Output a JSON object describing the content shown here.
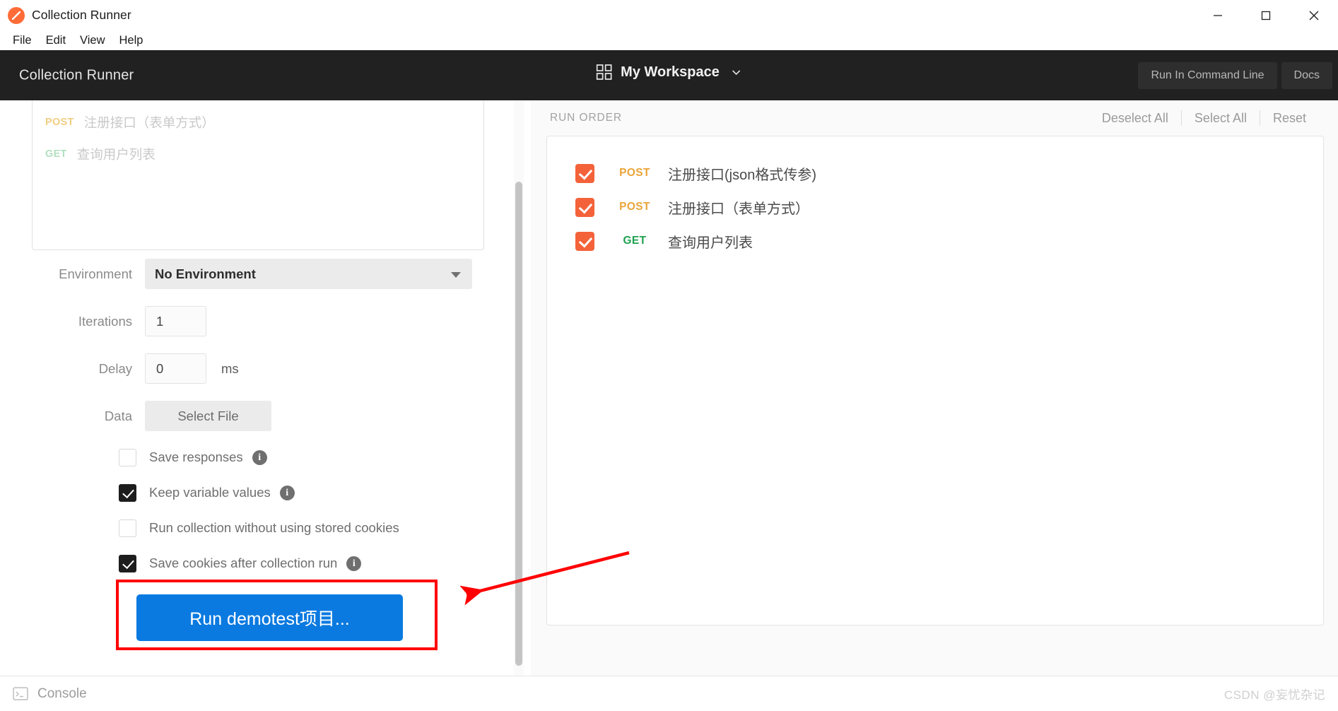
{
  "window": {
    "title": "Collection Runner",
    "app_icon": "postman-logo-icon",
    "controls": {
      "minimize": "minimize-icon",
      "maximize": "maximize-icon",
      "close": "close-icon"
    }
  },
  "menubar": {
    "items": [
      "File",
      "Edit",
      "View",
      "Help"
    ]
  },
  "header": {
    "title": "Collection Runner",
    "workspace": {
      "icon": "grid-icon",
      "name": "My Workspace",
      "chevron": "chevron-down-icon"
    },
    "actions": [
      {
        "label": "Run In Command Line"
      },
      {
        "label": "Docs"
      }
    ]
  },
  "left_panel": {
    "request_preview": [
      {
        "method": "POST",
        "name": "注册接口（表单方式）"
      },
      {
        "method": "GET",
        "name": "查询用户列表"
      }
    ],
    "form": {
      "environment": {
        "label": "Environment",
        "value": "No Environment"
      },
      "iterations": {
        "label": "Iterations",
        "value": "1"
      },
      "delay": {
        "label": "Delay",
        "value": "0",
        "unit": "ms"
      },
      "data": {
        "label": "Data",
        "button": "Select File"
      },
      "options": [
        {
          "label": "Save responses",
          "checked": false,
          "info": true
        },
        {
          "label": "Keep variable values",
          "checked": true,
          "info": true
        },
        {
          "label": "Run collection without using stored cookies",
          "checked": false,
          "info": false
        },
        {
          "label": "Save cookies after collection run",
          "checked": true,
          "info": true
        }
      ]
    },
    "run_button": {
      "label": "Run demotest项目...",
      "color": "#0b7ae0",
      "highlight_color": "#ff0000"
    }
  },
  "right_panel": {
    "heading": "RUN ORDER",
    "actions": [
      "Deselect All",
      "Select All",
      "Reset"
    ],
    "requests": [
      {
        "checked": true,
        "method": "POST",
        "name": "注册接口(json格式传参)"
      },
      {
        "checked": true,
        "method": "POST",
        "name": "注册接口（表单方式）"
      },
      {
        "checked": true,
        "method": "GET",
        "name": "查询用户列表"
      }
    ]
  },
  "footer": {
    "console": {
      "icon": "terminal-icon",
      "label": "Console"
    },
    "watermark": "CSDN @妄忧杂记"
  },
  "colors": {
    "header_bg": "#212121",
    "post": "#eaa439",
    "get": "#1fa14f",
    "checkbox_orange": "#f4623a",
    "run_blue": "#0b7ae0",
    "annotation_red": "#ff0000"
  }
}
